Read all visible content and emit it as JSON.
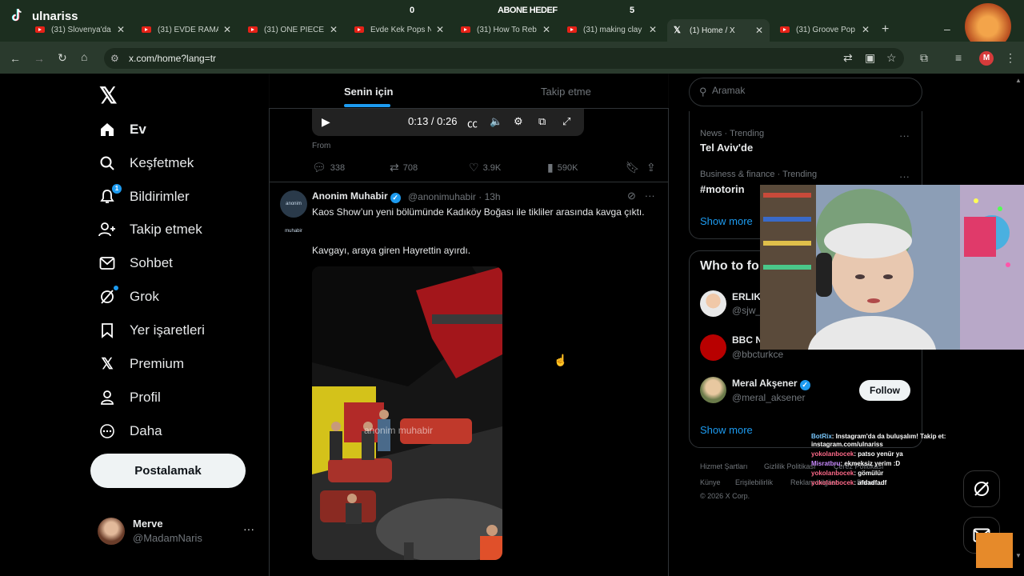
{
  "stream_overlay": {
    "streamer": "ulnariss",
    "goal_left": "0",
    "goal_label": "ABONE HEDEF",
    "goal_right": "5"
  },
  "browser": {
    "tabs": [
      {
        "title": "(31) Slovenya'da",
        "icon": "youtube-icon"
      },
      {
        "title": "(31) EVDE RAMA",
        "icon": "youtube-icon"
      },
      {
        "title": "(31) ONE PIECE |",
        "icon": "youtube-icon"
      },
      {
        "title": "Evde Kek Pops N",
        "icon": "youtube-icon"
      },
      {
        "title": "(31) How To Reb",
        "icon": "youtube-icon"
      },
      {
        "title": "(31) making clay",
        "icon": "youtube-icon"
      },
      {
        "title": "(1) Home / X",
        "icon": "x-icon",
        "active": true
      },
      {
        "title": "(31) Groove Pop",
        "icon": "youtube-icon"
      }
    ],
    "url": "x.com/home?lang=tr",
    "profile_letter": "M"
  },
  "sidebar": {
    "items": [
      {
        "label": "Ev",
        "icon": "home-icon"
      },
      {
        "label": "Keşfetmek",
        "icon": "search-icon"
      },
      {
        "label": "Bildirimler",
        "icon": "bell-icon",
        "badge": "1"
      },
      {
        "label": "Takip etmek",
        "icon": "add-person-icon"
      },
      {
        "label": "Sohbet",
        "icon": "mail-icon"
      },
      {
        "label": "Grok",
        "icon": "grok-icon"
      },
      {
        "label": "Yer işaretleri",
        "icon": "bookmark-icon"
      },
      {
        "label": "Premium",
        "icon": "x-logo-icon"
      },
      {
        "label": "Profil",
        "icon": "person-icon"
      },
      {
        "label": "Daha",
        "icon": "more-circle-icon"
      }
    ],
    "post_button": "Postalamak",
    "account": {
      "name": "Merve",
      "handle": "@MadamNaris"
    }
  },
  "feed": {
    "tabs": [
      "Senin için",
      "Takip etme"
    ],
    "prev_post": {
      "video_time": "0:13 / 0:26",
      "from": "From",
      "replies": "338",
      "reposts": "708",
      "likes": "3.9K",
      "views": "590K"
    },
    "post": {
      "avatar_text": "anonim muhabir",
      "name": "Anonim Muhabir",
      "handle": "@anonimuhabir",
      "time": "13h",
      "text": "Kaos Show’un yeni bölümünde Kadıköy Boğası ile tikliler arasında kavga çıktı.",
      "text2": "Kavgayı, araya giren Hayrettin ayırdı.",
      "watermark": "anonim muhabir"
    }
  },
  "right": {
    "search_placeholder": "Aramak",
    "trends": [
      {
        "context": "News · Trending",
        "title": "Tel Aviv'de"
      },
      {
        "context": "Business & finance · Trending",
        "title": "#motorin"
      }
    ],
    "show_more": "Show more",
    "who_to_follow": {
      "title": "Who to fo",
      "accounts": [
        {
          "name": "ERLIK",
          "handle": "@sjw_e"
        },
        {
          "name": "BBC N",
          "handle": "@bbcturkce"
        },
        {
          "name": "Meral Akşener",
          "handle": "@meral_aksener",
          "follow": "Follow"
        }
      ],
      "show_more": "Show more"
    },
    "footer": {
      "row1": [
        "Hizmet Şartları",
        "Gizlilik Politikası",
        "Çerez Politikası"
      ],
      "row2": [
        "Künye",
        "Erişilebilirlik",
        "Reklam bilgileri",
        "Daha ..."
      ],
      "copyright": "© 2026 X Corp."
    }
  },
  "chat": [
    {
      "user": "BotRix",
      "msg": ": Instagram'da da buluşalım! Takip et: instagram.com/ulnariss"
    },
    {
      "user": "yokolanbocek",
      "msg": ": patso yenür ya"
    },
    {
      "user": "Misratbru",
      "msg": ": ekmeksiz yerim :D"
    },
    {
      "user": "yokolanbocek",
      "msg": ": gömülür"
    },
    {
      "user": "yokolanbocek",
      "msg": ": afdadfadf"
    }
  ]
}
